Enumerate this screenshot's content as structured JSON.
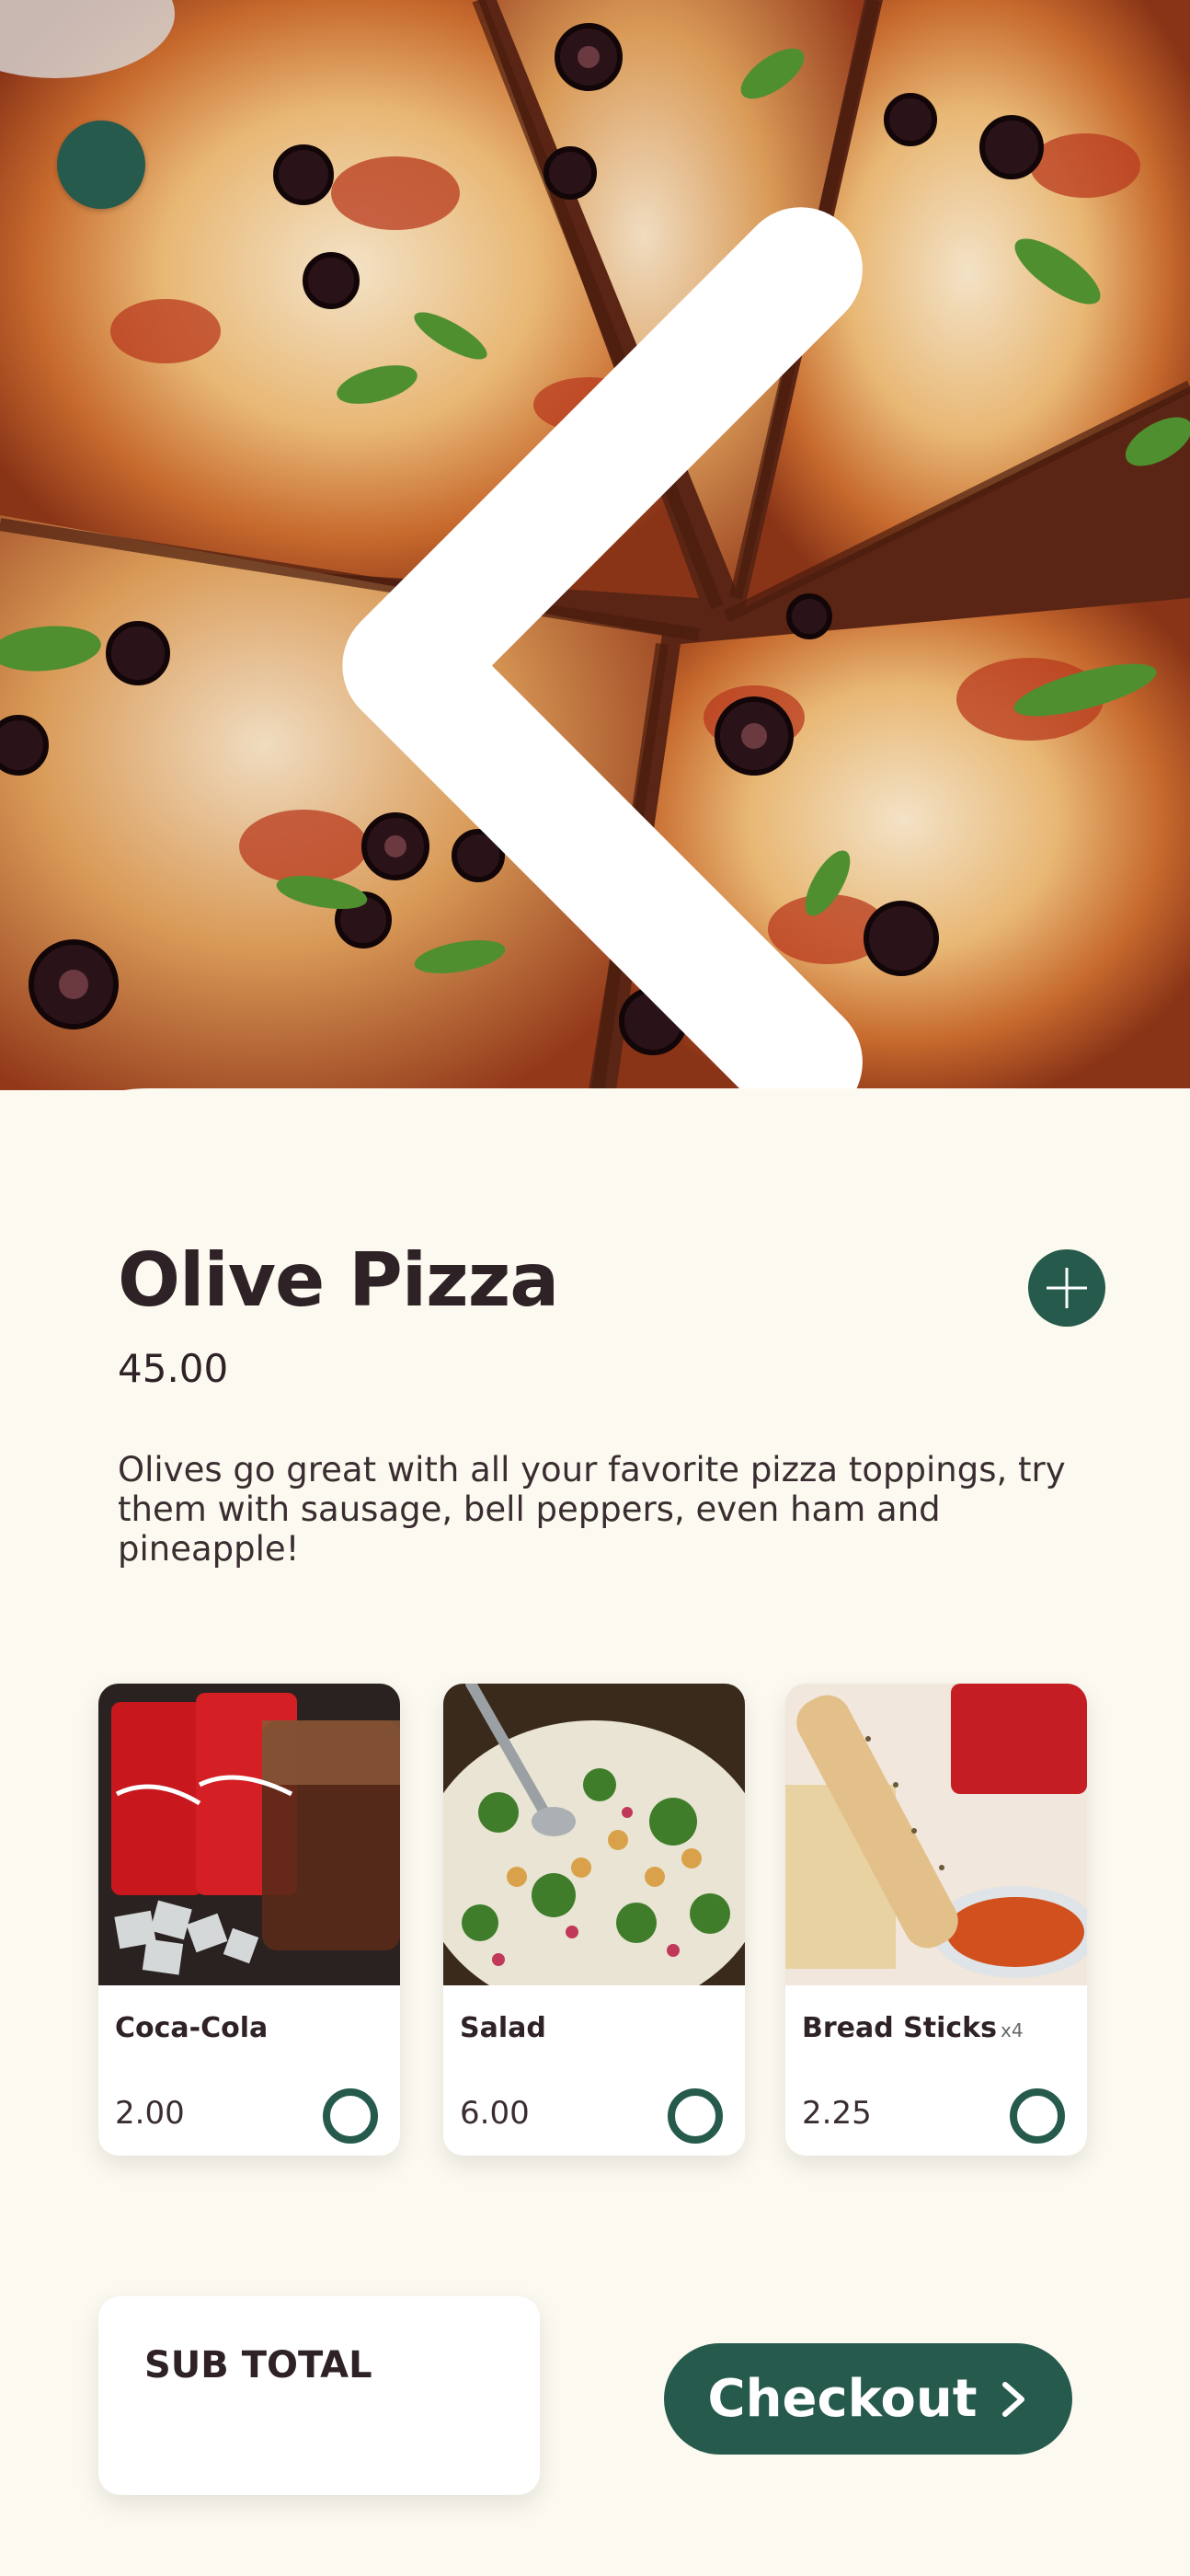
{
  "product": {
    "title": "Olive Pizza",
    "price": "45.00",
    "description": "Olives go great with all your favorite pizza toppings, try them with sausage, bell peppers, even ham and pineapple!"
  },
  "extras": [
    {
      "name": "Coca-Cola",
      "qty": "",
      "price": "2.00"
    },
    {
      "name": "Salad",
      "qty": "",
      "price": "6.00"
    },
    {
      "name": "Bread Sticks",
      "qty": "x4",
      "price": "2.25"
    }
  ],
  "footer": {
    "subtotal_label": "SUB TOTAL",
    "checkout_label": "Checkout"
  },
  "icons": {
    "back": "chevron-left-icon",
    "add": "plus-icon",
    "checkout": "chevron-right-icon",
    "select": "radio-circle-icon"
  },
  "colors": {
    "accent": "#265a4d",
    "background": "#fcfaf0",
    "text": "#2f2226"
  }
}
